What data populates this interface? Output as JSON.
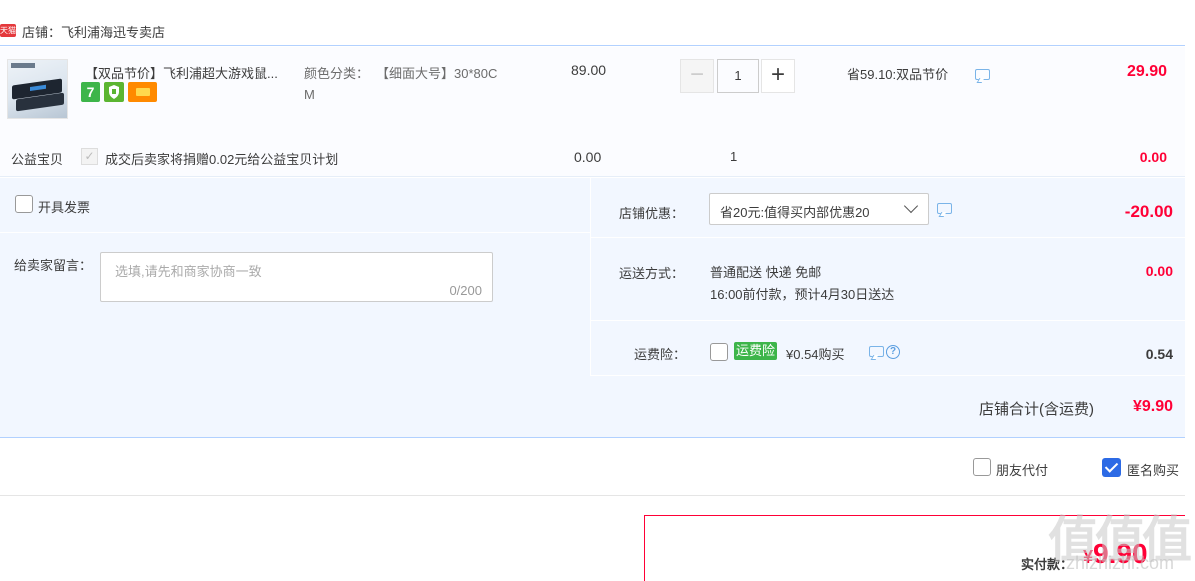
{
  "shop": {
    "tmall_badge": "天猫",
    "name": "店铺：飞利浦海迅专卖店"
  },
  "item": {
    "title": "【双品节价】飞利浦超大游戏鼠...",
    "sku_label": "颜色分类：",
    "sku_value": "【细面大号】30*80C",
    "sku_value_wrap": "M",
    "badges": [
      "7",
      "shield",
      "card"
    ],
    "badge_7_text": "7",
    "unit_price": "89.00",
    "quantity": "1",
    "minus_label": "−",
    "plus_label": "+",
    "promo": "省59.10:双品节价",
    "total": "29.90"
  },
  "charity": {
    "label": "公益宝贝",
    "check_mark": "✓",
    "text": "成交后卖家将捐赠0.02元给公益宝贝计划",
    "price": "0.00",
    "qty": "1",
    "total": "0.00"
  },
  "options": {
    "invoice_label": "开具发票",
    "message_label": "给卖家留言：",
    "message_placeholder": "选填,请先和商家协商一致",
    "message_count": "0/200",
    "discount_label": "店铺优惠：",
    "discount_selected": "省20元:值得买内部优惠20",
    "discount_amount": "-20.00",
    "shipping_label": "运送方式：",
    "shipping_line1": "普通配送 快递 免邮",
    "shipping_line2": "16:00前付款，预计4月30日送达",
    "shipping_amount": "0.00",
    "insurance_label": "运费险：",
    "insurance_badge": "运费险",
    "insurance_text": "¥0.54购买",
    "help_glyph": "?",
    "insurance_amount": "0.54",
    "shop_total_label": "店铺合计(含运费)",
    "shop_total_amount": "¥9.90"
  },
  "bottom": {
    "friend_pay_label": "朋友代付",
    "anonymous_label": "匿名购买",
    "anonymous_checked": true,
    "pay_label": "实付款：",
    "pay_yen": "¥",
    "pay_amount": "9.90"
  },
  "watermark": {
    "text": "值值值",
    "sub": "zhizhizhi.com"
  },
  "colors": {
    "price_red": "#ff0036",
    "panel_bg": "#f2f7ff",
    "border_blue": "#b2d1ff",
    "check_blue": "#2c6ae5",
    "badge_green": "#3db54a"
  }
}
